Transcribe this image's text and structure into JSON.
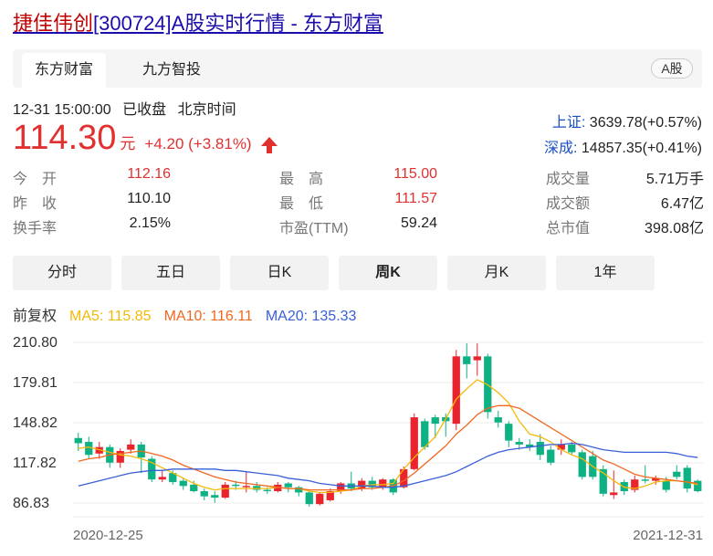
{
  "title": {
    "name": "捷佳伟创",
    "rest": "[300724]A股实时行情 - 东方财富"
  },
  "tabs": [
    {
      "label": "东方财富",
      "active": true
    },
    {
      "label": "九方智投",
      "active": false
    }
  ],
  "market_badge": "A股",
  "status": {
    "datetime": "12-31 15:00:00",
    "state": "已收盘",
    "tz": "北京时间"
  },
  "quote": {
    "price": "114.30",
    "unit": "元",
    "change": "+4.20 (+3.81%)"
  },
  "indices": [
    {
      "label": "上证:",
      "value": "3639.78(+0.57%)"
    },
    {
      "label": "深成:",
      "value": "14857.35(+0.41%)"
    }
  ],
  "stats": {
    "open": {
      "label": "今　开",
      "value": "112.16"
    },
    "prev_close": {
      "label": "昨　收",
      "value": "110.10"
    },
    "turnover_rate": {
      "label": "换手率",
      "value": "2.15%"
    },
    "high": {
      "label": "最　高",
      "value": "115.00"
    },
    "low": {
      "label": "最　低",
      "value": "111.57"
    },
    "pe": {
      "label": "市盈(TTM)",
      "value": "59.24"
    },
    "volume": {
      "label": "成交量",
      "value": "5.71万手"
    },
    "amount": {
      "label": "成交额",
      "value": "6.47亿"
    },
    "market_cap": {
      "label": "总市值",
      "value": "398.08亿"
    }
  },
  "periods": [
    {
      "label": "分时",
      "active": false
    },
    {
      "label": "五日",
      "active": false
    },
    {
      "label": "日K",
      "active": false
    },
    {
      "label": "周K",
      "active": true
    },
    {
      "label": "月K",
      "active": false
    },
    {
      "label": "1年",
      "active": false
    }
  ],
  "legend": {
    "adjust": "前复权",
    "ma5": "MA5: 115.85",
    "ma10": "MA10: 116.11",
    "ma20": "MA20: 135.33"
  },
  "colors": {
    "up": "#e8242c",
    "down": "#0db183",
    "ma5": "#f5b90a",
    "ma10": "#f0681f",
    "ma20": "#3a5fd8"
  },
  "chart_data": {
    "type": "candlestick",
    "y_ticks": [
      "210.80",
      "179.81",
      "148.82",
      "117.82",
      "86.83"
    ],
    "ylim": [
      86.83,
      210.8
    ],
    "x_labels": [
      "2020-12-25",
      "2021-12-31"
    ],
    "candles": [
      {
        "o": 137,
        "c": 133,
        "h": 141,
        "l": 127
      },
      {
        "o": 134,
        "c": 124,
        "h": 138,
        "l": 121
      },
      {
        "o": 125,
        "c": 130,
        "h": 134,
        "l": 121
      },
      {
        "o": 130,
        "c": 118,
        "h": 132,
        "l": 114
      },
      {
        "o": 118,
        "c": 127,
        "h": 129,
        "l": 114
      },
      {
        "o": 128,
        "c": 132,
        "h": 136,
        "l": 125
      },
      {
        "o": 132,
        "c": 122,
        "h": 134,
        "l": 110
      },
      {
        "o": 121,
        "c": 105,
        "h": 123,
        "l": 103
      },
      {
        "o": 105,
        "c": 107,
        "h": 112,
        "l": 103
      },
      {
        "o": 110,
        "c": 103,
        "h": 112,
        "l": 101
      },
      {
        "o": 104,
        "c": 100,
        "h": 106,
        "l": 97
      },
      {
        "o": 101,
        "c": 96,
        "h": 104,
        "l": 95
      },
      {
        "o": 96,
        "c": 92,
        "h": 98,
        "l": 89
      },
      {
        "o": 93,
        "c": 91,
        "h": 96,
        "l": 87
      },
      {
        "o": 91,
        "c": 101,
        "h": 103,
        "l": 90
      },
      {
        "o": 101,
        "c": 100,
        "h": 104,
        "l": 97
      },
      {
        "o": 99,
        "c": 100,
        "h": 111,
        "l": 95
      },
      {
        "o": 100,
        "c": 97,
        "h": 103,
        "l": 95
      },
      {
        "o": 97,
        "c": 96,
        "h": 99,
        "l": 94
      },
      {
        "o": 96,
        "c": 101,
        "h": 103,
        "l": 95
      },
      {
        "o": 102,
        "c": 99,
        "h": 103,
        "l": 95
      },
      {
        "o": 99,
        "c": 95,
        "h": 100,
        "l": 92
      },
      {
        "o": 95,
        "c": 86,
        "h": 96,
        "l": 84
      },
      {
        "o": 86,
        "c": 94,
        "h": 95,
        "l": 85
      },
      {
        "o": 89,
        "c": 96,
        "h": 98,
        "l": 88
      },
      {
        "o": 96,
        "c": 102,
        "h": 103,
        "l": 94
      },
      {
        "o": 102,
        "c": 98,
        "h": 111,
        "l": 96
      },
      {
        "o": 98,
        "c": 104,
        "h": 106,
        "l": 96
      },
      {
        "o": 104,
        "c": 99,
        "h": 107,
        "l": 97
      },
      {
        "o": 99,
        "c": 105,
        "h": 106,
        "l": 97
      },
      {
        "o": 105,
        "c": 95,
        "h": 106,
        "l": 93
      },
      {
        "o": 99,
        "c": 113,
        "h": 115,
        "l": 98
      },
      {
        "o": 113,
        "c": 153,
        "h": 156,
        "l": 112
      },
      {
        "o": 150,
        "c": 130,
        "h": 152,
        "l": 128
      },
      {
        "o": 153,
        "c": 148,
        "h": 155,
        "l": 137
      },
      {
        "o": 153,
        "c": 150,
        "h": 156,
        "l": 138
      },
      {
        "o": 148,
        "c": 200,
        "h": 205,
        "l": 143
      },
      {
        "o": 200,
        "c": 194,
        "h": 210,
        "l": 183
      },
      {
        "o": 197,
        "c": 200,
        "h": 210,
        "l": 185
      },
      {
        "o": 200,
        "c": 157,
        "h": 202,
        "l": 152
      },
      {
        "o": 153,
        "c": 149,
        "h": 158,
        "l": 145
      },
      {
        "o": 148,
        "c": 135,
        "h": 150,
        "l": 130
      },
      {
        "o": 134,
        "c": 132,
        "h": 137,
        "l": 128
      },
      {
        "o": 132,
        "c": 130,
        "h": 136,
        "l": 127
      },
      {
        "o": 134,
        "c": 124,
        "h": 140,
        "l": 120
      },
      {
        "o": 128,
        "c": 118,
        "h": 131,
        "l": 116
      },
      {
        "o": 128,
        "c": 132,
        "h": 136,
        "l": 124
      },
      {
        "o": 132,
        "c": 126,
        "h": 134,
        "l": 124
      },
      {
        "o": 126,
        "c": 107,
        "h": 128,
        "l": 105
      },
      {
        "o": 123,
        "c": 107,
        "h": 127,
        "l": 105
      },
      {
        "o": 113,
        "c": 94,
        "h": 116,
        "l": 92
      },
      {
        "o": 93,
        "c": 95,
        "h": 112,
        "l": 90
      },
      {
        "o": 103,
        "c": 96,
        "h": 105,
        "l": 93
      },
      {
        "o": 97,
        "c": 105,
        "h": 108,
        "l": 95
      },
      {
        "o": 105,
        "c": 104,
        "h": 116,
        "l": 102
      },
      {
        "o": 104,
        "c": 106,
        "h": 108,
        "l": 101
      },
      {
        "o": 104,
        "c": 97,
        "h": 107,
        "l": 95
      },
      {
        "o": 111,
        "c": 107,
        "h": 116,
        "l": 105
      },
      {
        "o": 114,
        "c": 98,
        "h": 116,
        "l": 95
      },
      {
        "o": 104,
        "c": 96,
        "h": 105,
        "l": 95
      }
    ],
    "series": [
      {
        "name": "MA5",
        "values": [
          129,
          130,
          128,
          126,
          124,
          123,
          121,
          118,
          114,
          110,
          106,
          102,
          99,
          97,
          98,
          98,
          98,
          98,
          98,
          99,
          98,
          98,
          96,
          95,
          95,
          96,
          97,
          100,
          101,
          101,
          102,
          113,
          122,
          130,
          138,
          152,
          167,
          175,
          182,
          178,
          172,
          164,
          150,
          140,
          138,
          134,
          128,
          124,
          121,
          115,
          110,
          104,
          99,
          98,
          100,
          103,
          104,
          104,
          103,
          101
        ]
      },
      {
        "name": "MA10",
        "values": [
          119,
          121,
          122,
          124,
          125,
          126,
          127,
          125,
          123,
          120,
          116,
          113,
          110,
          107,
          105,
          103,
          102,
          101,
          100,
          99,
          98,
          98,
          97,
          97,
          97,
          97,
          97,
          98,
          98,
          99,
          100,
          104,
          110,
          117,
          124,
          131,
          140,
          147,
          155,
          160,
          162,
          162,
          160,
          155,
          150,
          145,
          140,
          135,
          130,
          125,
          120,
          117,
          113,
          109,
          107,
          106,
          105,
          104,
          103,
          102
        ]
      },
      {
        "name": "MA20",
        "values": [
          100,
          102,
          104,
          106,
          108,
          110,
          111,
          112,
          112,
          113,
          113,
          113,
          113,
          113,
          112,
          112,
          111,
          110,
          109,
          108,
          106,
          105,
          104,
          102,
          101,
          100,
          100,
          100,
          100,
          99,
          99,
          100,
          102,
          104,
          106,
          108,
          111,
          115,
          119,
          123,
          126,
          128,
          129,
          130,
          131,
          132,
          132,
          133,
          132,
          130,
          128,
          127,
          126,
          126,
          126,
          126,
          126,
          125,
          123,
          122
        ]
      }
    ]
  }
}
